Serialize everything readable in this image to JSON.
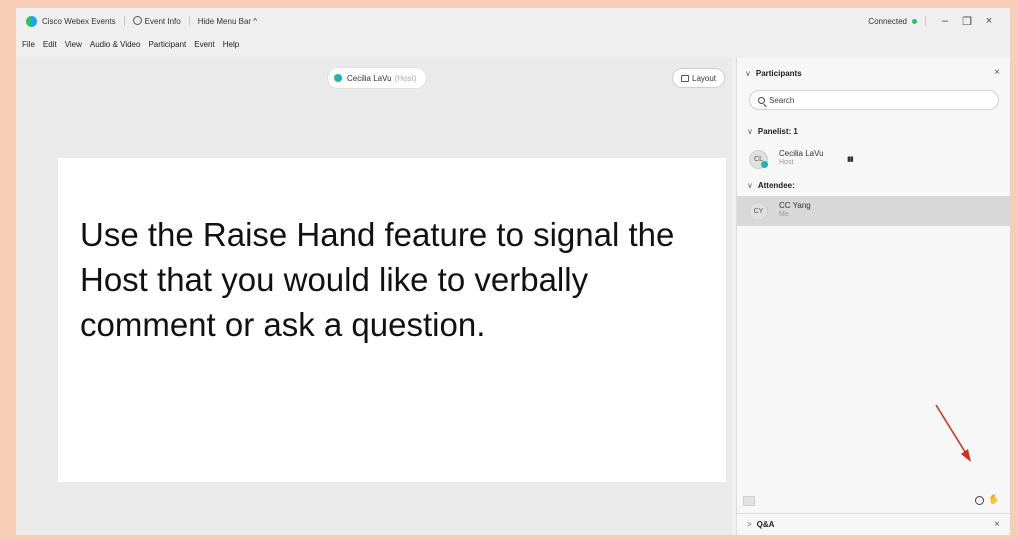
{
  "titlebar": {
    "app_name": "Cisco Webex Events",
    "event_info": "Event Info",
    "hide_menu": "Hide Menu Bar ^",
    "connection_status": "Connected",
    "minimize": "–",
    "maximize": "❐",
    "close": "×"
  },
  "menubar": {
    "items": [
      "File",
      "Edit",
      "View",
      "Audio & Video",
      "Participant",
      "Event",
      "Help"
    ]
  },
  "stage": {
    "host_name": "Cecilia LaVu",
    "host_role": "(Host)",
    "layout_label": "Layout",
    "overlay_text": "Use the Raise Hand feature to signal the Host that you would like to verbally comment or ask a question."
  },
  "participants_panel": {
    "title": "Participants",
    "close": "×",
    "search_placeholder": "Search",
    "panelist_group": "Panelist: 1",
    "attendee_group": "Attendee:",
    "panelists": [
      {
        "initials": "CL",
        "name": "Cecilia LaVu",
        "role": "Host"
      }
    ],
    "attendees": [
      {
        "initials": "CY",
        "name": "CC Yang",
        "role": "Me"
      }
    ]
  },
  "qa_panel": {
    "title": "Q&A",
    "close": "×"
  },
  "colors": {
    "frame_border": "#f6cdb5",
    "annotation_arrow": "#d2301e",
    "status_green": "#2dbf6a",
    "selected_row": "#d8d8d8"
  }
}
